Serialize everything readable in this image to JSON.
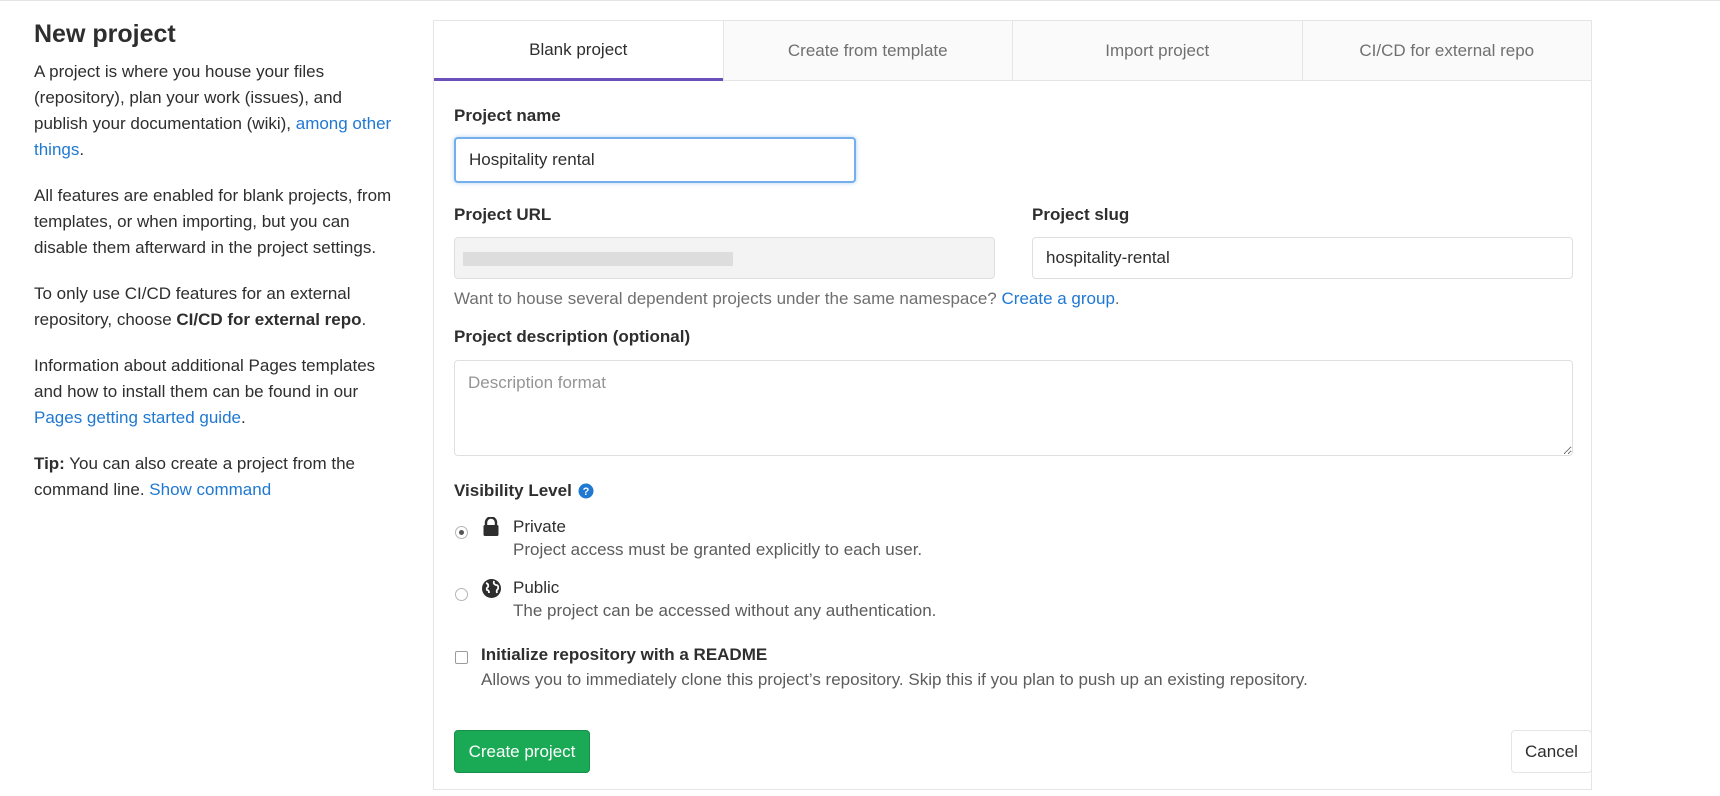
{
  "sidebar": {
    "title": "New project",
    "p1_text": "A project is where you house your files (repository), plan your work (issues), and publish your documentation (wiki), ",
    "p1_link": "among other things",
    "p1_end": ".",
    "p2": "All features are enabled for blank projects, from templates, or when importing, but you can disable them afterward in the project settings.",
    "p3_text": "To only use CI/CD features for an external repository, choose ",
    "p3_bold": "CI/CD for external repo",
    "p3_end": ".",
    "p4_text": "Information about additional Pages templates and how to install them can be found in our ",
    "p4_link": "Pages getting started guide",
    "p4_end": ".",
    "tip_label": "Tip:",
    "tip_text": " You can also create a project from the command line. ",
    "tip_link": "Show command"
  },
  "tabs": [
    {
      "label": "Blank project",
      "active": true
    },
    {
      "label": "Create from template",
      "active": false
    },
    {
      "label": "Import project",
      "active": false
    },
    {
      "label": "CI/CD for external repo",
      "active": false
    }
  ],
  "form": {
    "project_name_label": "Project name",
    "project_name_value": "Hospitality rental",
    "project_url_label": "Project URL",
    "project_slug_label": "Project slug",
    "project_slug_value": "hospitality-rental",
    "namespace_help": "Want to house several dependent projects under the same namespace? ",
    "namespace_link": "Create a group",
    "namespace_end": ".",
    "description_label": "Project description (optional)",
    "description_placeholder": "Description format",
    "visibility_label": "Visibility Level",
    "visibility_options": [
      {
        "title": "Private",
        "desc": "Project access must be granted explicitly to each user.",
        "icon": "lock-icon",
        "checked": true
      },
      {
        "title": "Public",
        "desc": "The project can be accessed without any authentication.",
        "icon": "globe-icon",
        "checked": false
      }
    ],
    "readme_label": "Initialize repository with a README",
    "readme_desc": "Allows you to immediately clone this project’s repository. Skip this if you plan to push up an existing repository.",
    "create_button": "Create project",
    "cancel_button": "Cancel"
  },
  "colors": {
    "accent_tab": "#6b4fbb",
    "link": "#1f78d1",
    "success": "#1aaa55"
  }
}
